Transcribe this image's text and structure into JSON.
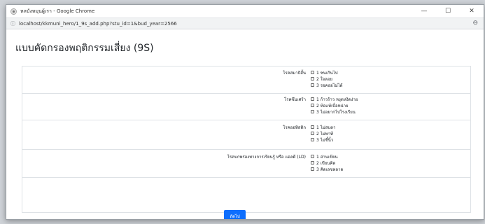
{
  "window": {
    "title": "หลบังหมุนผู้เรา - Google Chrome",
    "url": "localhost/kkmuni_hero/1_9s_add.php?stu_id=1&bud_year=2566"
  },
  "page": {
    "title": "แบบคัดกรองพฤติกรรมเสี่ยง (9S)"
  },
  "groups": [
    {
      "label": "โรคสมาธิสั้น",
      "options": [
        "1 ซนเกินไป",
        "2 ใจลอย",
        "3 รอคอยไม่ได้"
      ]
    },
    {
      "label": "โรคซึมเศร้า",
      "options": [
        "1 ก้าวร้าว หงุดหงิดง่าย",
        "2 ท้อแท้เบื่อหน่าย",
        "3 ไม่อยากไปโรงเรียน"
      ]
    },
    {
      "label": "โรคออทิสติก",
      "options": [
        "1 ไม่สบตา",
        "2 ไม่พาที",
        "3 ไม่ชี้นิ้ว"
      ]
    },
    {
      "label": "โรคบกพร่องทางการเรียนรู้ หรือ แอลดี (LD)",
      "options": [
        "1 อ่านเขียน",
        "2 เขียนคิด",
        "3 คิดเลขพลาด"
      ]
    }
  ],
  "actions": {
    "next_label": "ถัดไป"
  }
}
